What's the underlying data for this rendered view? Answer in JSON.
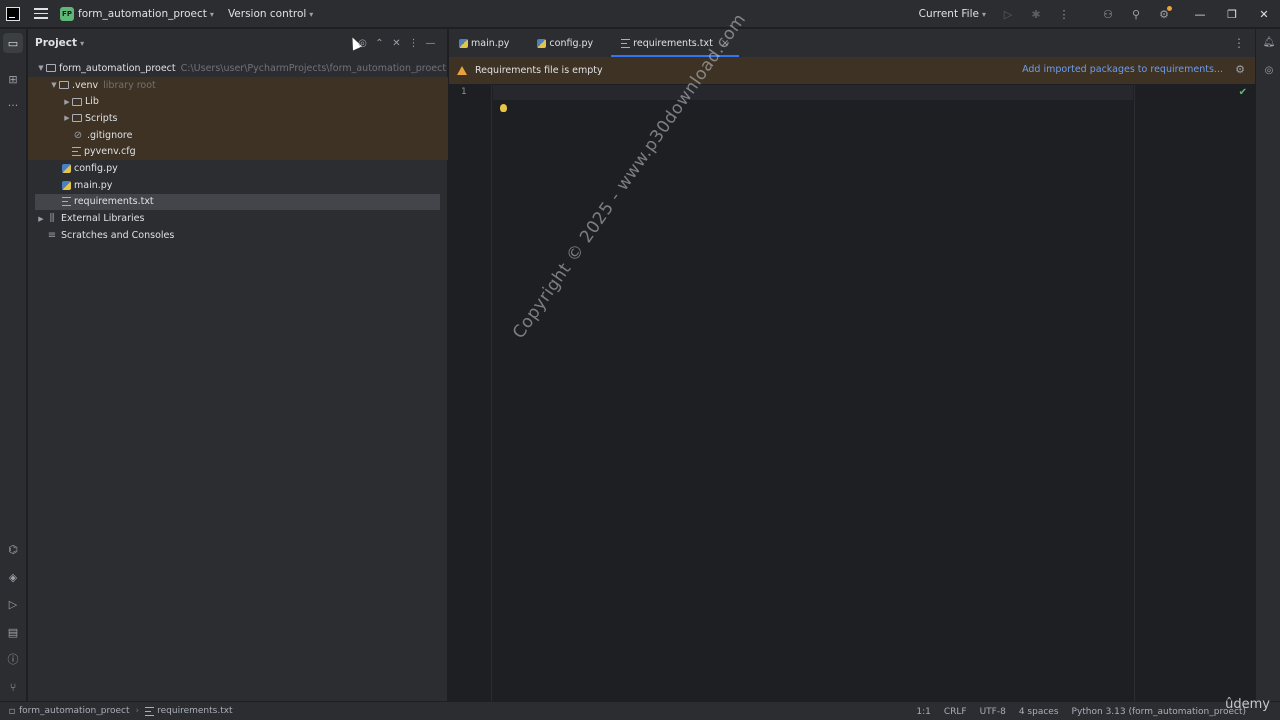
{
  "titlebar": {
    "project_badge": "FP",
    "project_name": "form_automation_proect",
    "vcs": "Version control",
    "run_config": "Current File"
  },
  "project_panel": {
    "title": "Project",
    "tree": [
      {
        "label": "form_automation_proect",
        "hint": "C:\\Users\\user\\PycharmProjects\\form_automation_proect"
      },
      {
        "label": ".venv",
        "hint": "library root"
      },
      {
        "label": "Lib"
      },
      {
        "label": "Scripts"
      },
      {
        "label": ".gitignore"
      },
      {
        "label": "pyvenv.cfg"
      },
      {
        "label": "config.py"
      },
      {
        "label": "main.py"
      },
      {
        "label": "requirements.txt"
      },
      {
        "label": "External Libraries"
      },
      {
        "label": "Scratches and Consoles"
      }
    ]
  },
  "editor": {
    "tabs": [
      {
        "label": "main.py"
      },
      {
        "label": "config.py"
      },
      {
        "label": "requirements.txt",
        "close": "×"
      }
    ],
    "banner": {
      "message": "Requirements file is empty",
      "action": "Add imported packages to requirements..."
    },
    "line_number": "1",
    "watermark": "Copyright © 2025 - www.p30download.com"
  },
  "statusbar": {
    "breadcrumb_project": "form_automation_proect",
    "breadcrumb_file": "requirements.txt",
    "position": "1:1",
    "line_ending": "CRLF",
    "encoding": "UTF-8",
    "indent": "4 spaces",
    "interpreter": "Python 3.13 (form_automation_proect)"
  },
  "brand": "ûdemy",
  "colors": {
    "background": "#1e1f22",
    "panel": "#2b2d30",
    "accent": "#3574f0",
    "warning_bg": "#3d3223",
    "warning": "#e8a33d",
    "link": "#6d9cf0"
  }
}
